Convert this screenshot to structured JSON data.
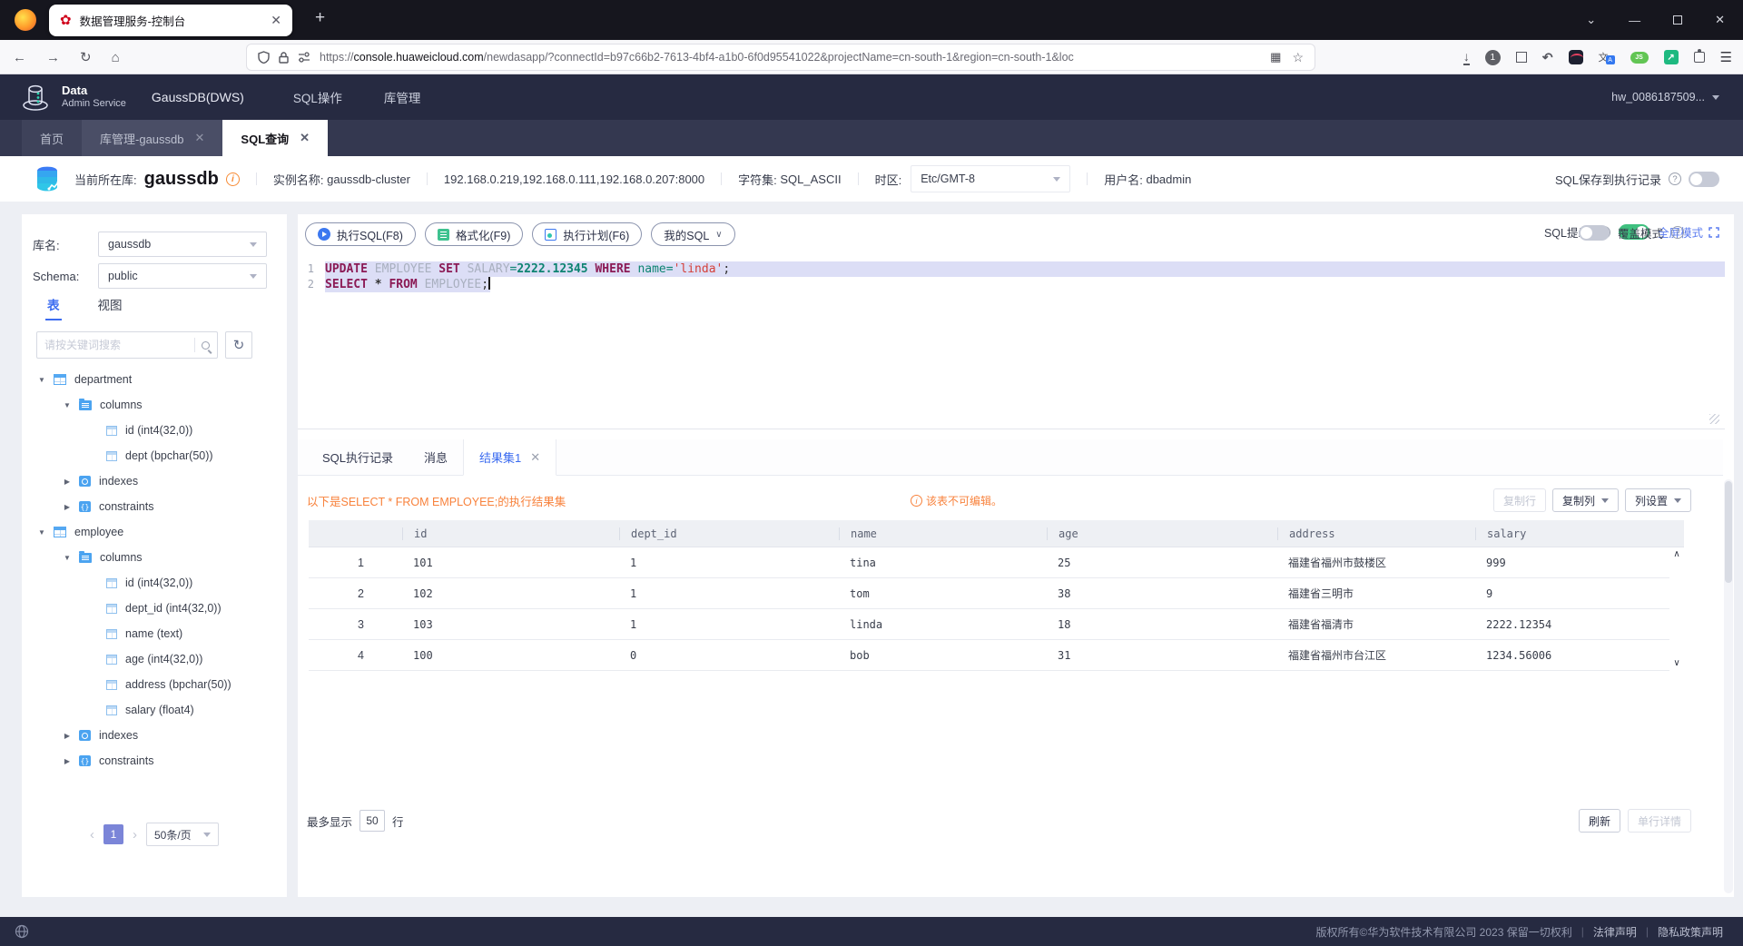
{
  "theme": {
    "accent_blue": "#3c6cf0",
    "toggle_green": "#3fc07f",
    "warning_orange": "#f8823c",
    "header_navy": "#262a41",
    "selection_lavender": "#dcdef6"
  },
  "browser": {
    "tab_title": "数据管理服务-控制台",
    "badge_count": "1",
    "url_scheme": "https://",
    "url_host": "console.huaweicloud.com",
    "url_path": "/newdasapp/?connectId=b97c66b2-7613-4bf4-a1b0-6f0d95541022&projectName=cn-south-1&region=cn-south-1&loc"
  },
  "header": {
    "logo_line1": "Data",
    "logo_line2": "Admin Service",
    "product": "GaussDB(DWS)",
    "nav_sql": "SQL操作",
    "nav_db": "库管理",
    "account": "hw_0086187509..."
  },
  "tabs": [
    {
      "label": "首页",
      "closable": false,
      "active": false
    },
    {
      "label": "库管理-gaussdb",
      "closable": true,
      "active": false
    },
    {
      "label": "SQL查询",
      "closable": true,
      "active": true
    }
  ],
  "infobar": {
    "current_db_label": "当前所在库:",
    "current_db": "gaussdb",
    "instance_label": "实例名称:",
    "instance": "gaussdb-cluster",
    "hosts": "192.168.0.219,192.168.0.111,192.168.0.207:8000",
    "charset_label": "字符集:",
    "charset": "SQL_ASCII",
    "timezone_label": "时区:",
    "timezone": "Etc/GMT-8",
    "user_label": "用户名:",
    "user": "dbadmin",
    "save_record_label": "SQL保存到执行记录"
  },
  "sidebar": {
    "db_label": "库名:",
    "db_value": "gaussdb",
    "schema_label": "Schema:",
    "schema_value": "public",
    "tab_table": "表",
    "tab_view": "视图",
    "search_placeholder": "请按关键词搜索",
    "tree": [
      {
        "level": 0,
        "arrow": "down",
        "icon": "table",
        "label": "department"
      },
      {
        "level": 1,
        "arrow": "down",
        "icon": "folder",
        "label": "columns"
      },
      {
        "level": 2,
        "arrow": "none",
        "icon": "column",
        "label": "id (int4(32,0))"
      },
      {
        "level": 2,
        "arrow": "none",
        "icon": "column",
        "label": "dept (bpchar(50))"
      },
      {
        "level": 1,
        "arrow": "right",
        "icon": "index",
        "label": "indexes"
      },
      {
        "level": 1,
        "arrow": "right",
        "icon": "constraint",
        "label": "constraints"
      },
      {
        "level": 0,
        "arrow": "down",
        "icon": "table",
        "label": "employee"
      },
      {
        "level": 1,
        "arrow": "down",
        "icon": "folder",
        "label": "columns"
      },
      {
        "level": 2,
        "arrow": "none",
        "icon": "column",
        "label": "id (int4(32,0))"
      },
      {
        "level": 2,
        "arrow": "none",
        "icon": "column",
        "label": "dept_id (int4(32,0))"
      },
      {
        "level": 2,
        "arrow": "none",
        "icon": "column",
        "label": "name (text)"
      },
      {
        "level": 2,
        "arrow": "none",
        "icon": "column",
        "label": "age (int4(32,0))"
      },
      {
        "level": 2,
        "arrow": "none",
        "icon": "column",
        "label": "address (bpchar(50))"
      },
      {
        "level": 2,
        "arrow": "none",
        "icon": "column",
        "label": "salary (float4)"
      },
      {
        "level": 1,
        "arrow": "right",
        "icon": "index",
        "label": "indexes"
      },
      {
        "level": 1,
        "arrow": "right",
        "icon": "constraint",
        "label": "constraints"
      }
    ],
    "pagination": {
      "page": "1",
      "page_size": "50条/页"
    }
  },
  "editor": {
    "btn_run": "执行SQL(F8)",
    "btn_format": "格式化(F9)",
    "btn_plan": "执行计划(F6)",
    "btn_mysql": "我的SQL",
    "sql_hint_label": "SQL提示",
    "fullscreen_label": "全屏模式",
    "lines": [
      {
        "num": "1",
        "selection": "full",
        "tokens": [
          {
            "text": "UPDATE",
            "type": "kw"
          },
          {
            "text": " ",
            "type": "plain"
          },
          {
            "text": "EMPLOYEE",
            "type": "ident"
          },
          {
            "text": " ",
            "type": "plain"
          },
          {
            "text": "SET",
            "type": "kw"
          },
          {
            "text": " ",
            "type": "plain"
          },
          {
            "text": "SALARY",
            "type": "ident"
          },
          {
            "text": "=",
            "type": "op"
          },
          {
            "text": "2222.12345",
            "type": "num"
          },
          {
            "text": " ",
            "type": "plain"
          },
          {
            "text": "WHERE",
            "type": "kw"
          },
          {
            "text": " ",
            "type": "plain"
          },
          {
            "text": "name",
            "type": "attr"
          },
          {
            "text": "=",
            "type": "op"
          },
          {
            "text": "'linda'",
            "type": "str"
          },
          {
            "text": ";",
            "type": "plain"
          }
        ]
      },
      {
        "num": "2",
        "selection": "text",
        "tokens": [
          {
            "text": "SELECT",
            "type": "kw"
          },
          {
            "text": " ",
            "type": "plain"
          },
          {
            "text": "*",
            "type": "star"
          },
          {
            "text": " ",
            "type": "plain"
          },
          {
            "text": "FROM",
            "type": "kw"
          },
          {
            "text": " ",
            "type": "plain"
          },
          {
            "text": "EMPLOYEE",
            "type": "ident"
          },
          {
            "text": ";",
            "type": "plain"
          }
        ]
      }
    ]
  },
  "results": {
    "tab_history": "SQL执行记录",
    "tab_message": "消息",
    "tab_resultset": "结果集1",
    "overwrite_label": "覆盖模式",
    "notice": "以下是SELECT * FROM EMPLOYEE;的执行结果集",
    "warning": "该表不可编辑。",
    "btn_copy_row": "复制行",
    "btn_copy_col": "复制列",
    "btn_col_settings": "列设置",
    "table": {
      "columns": [
        "id",
        "dept_id",
        "name",
        "age",
        "address",
        "salary"
      ],
      "rows": [
        [
          "101",
          "1",
          "tina",
          "25",
          "福建省福州市鼓楼区",
          "999"
        ],
        [
          "102",
          "1",
          "tom",
          "38",
          "福建省三明市",
          "9"
        ],
        [
          "103",
          "1",
          "linda",
          "18",
          "福建省福清市",
          "2222.12354"
        ],
        [
          "100",
          "0",
          "bob",
          "31",
          "福建省福州市台江区",
          "1234.56006"
        ]
      ]
    },
    "footer": {
      "max_label": "最多显示",
      "max_value": "50",
      "rows_label": "行",
      "btn_refresh": "刷新",
      "btn_row_detail": "单行详情"
    }
  },
  "footer": {
    "copyright": "版权所有©华为软件技术有限公司 2023 保留一切权利",
    "link_legal": "法律声明",
    "link_privacy": "隐私政策声明"
  }
}
